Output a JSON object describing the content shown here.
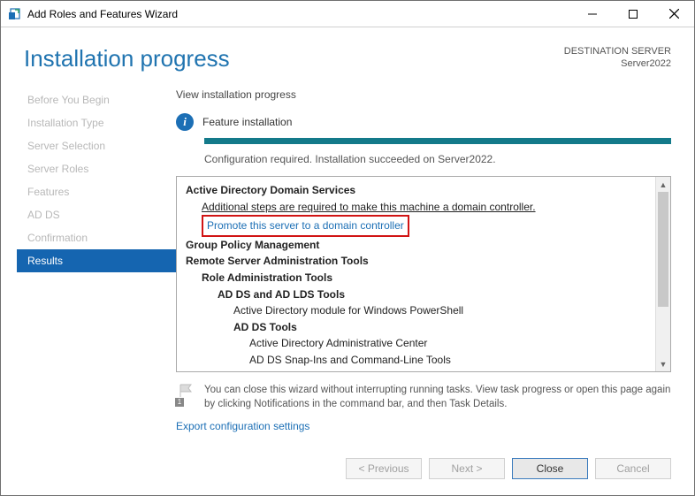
{
  "window": {
    "title": "Add Roles and Features Wizard"
  },
  "header": {
    "page_title": "Installation progress",
    "dest_label": "DESTINATION SERVER",
    "dest_name": "Server2022"
  },
  "nav": [
    {
      "label": "Before You Begin",
      "active": false
    },
    {
      "label": "Installation Type",
      "active": false
    },
    {
      "label": "Server Selection",
      "active": false
    },
    {
      "label": "Server Roles",
      "active": false
    },
    {
      "label": "Features",
      "active": false
    },
    {
      "label": "AD DS",
      "active": false
    },
    {
      "label": "Confirmation",
      "active": false
    },
    {
      "label": "Results",
      "active": true
    }
  ],
  "main": {
    "section_label": "View installation progress",
    "feature_label": "Feature installation",
    "progress_pct": 100,
    "status_text": "Configuration required. Installation succeeded on Server2022.",
    "details": {
      "adds_heading": "Active Directory Domain Services",
      "adds_note": "Additional steps are required to make this machine a domain controller.",
      "promote_link": "Promote this server to a domain controller",
      "gpm": "Group Policy Management",
      "rsat": "Remote Server Administration Tools",
      "role_admin": "Role Administration Tools",
      "adds_lds": "AD DS and AD LDS Tools",
      "ad_module": "Active Directory module for Windows PowerShell",
      "adds_tools": "AD DS Tools",
      "adac": "Active Directory Administrative Center",
      "snapins": "AD DS Snap-Ins and Command-Line Tools"
    },
    "note_text": "You can close this wizard without interrupting running tasks. View task progress or open this page again by clicking Notifications in the command bar, and then Task Details.",
    "flag_badge": "1",
    "export_link": "Export configuration settings"
  },
  "footer": {
    "previous": "< Previous",
    "next": "Next >",
    "close": "Close",
    "cancel": "Cancel"
  }
}
